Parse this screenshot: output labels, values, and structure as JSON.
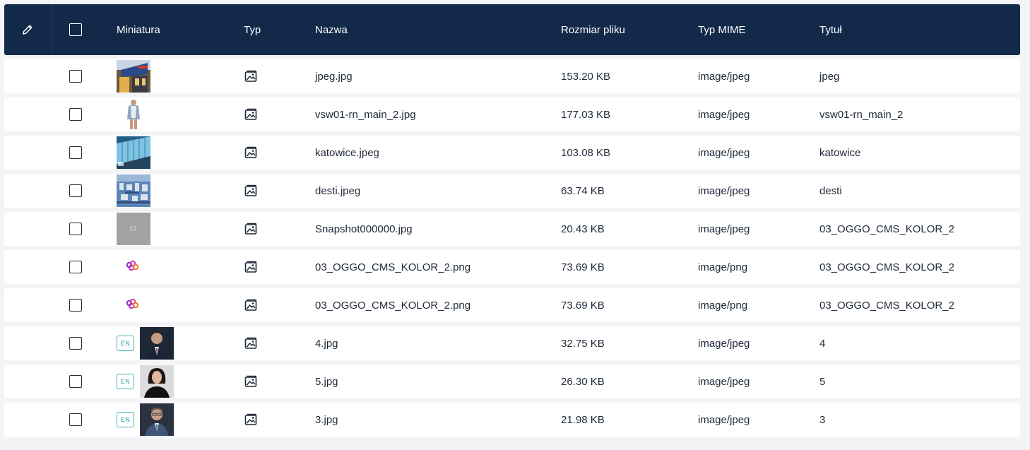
{
  "columns": {
    "thumbnail": "Miniatura",
    "type": "Typ",
    "name": "Nazwa",
    "file_size": "Rozmiar pliku",
    "mime": "Typ MIME",
    "title": "Tytuł"
  },
  "icons": {
    "edit": "pencil-icon",
    "type": "image-icon"
  },
  "rows": [
    {
      "thumb": "photo-building-facade",
      "lang": "",
      "name": "jpeg.jpg",
      "size": "153.20 KB",
      "mime": "image/jpeg",
      "title": "jpeg"
    },
    {
      "thumb": "photo-woman-cardigan",
      "lang": "",
      "name": "vsw01-rn_main_2.jpg",
      "size": "177.03 KB",
      "mime": "image/jpeg",
      "title": "vsw01-rn_main_2"
    },
    {
      "thumb": "photo-glass-building",
      "lang": "",
      "name": "katowice.jpeg",
      "size": "103.08 KB",
      "mime": "image/jpeg",
      "title": "katowice"
    },
    {
      "thumb": "photo-aerial-city",
      "lang": "",
      "name": "desti.jpeg",
      "size": "63.74 KB",
      "mime": "image/jpeg",
      "title": "desti"
    },
    {
      "thumb": "photo-gray-placeholder",
      "lang": "",
      "name": "Snapshot000000.jpg",
      "size": "20.43 KB",
      "mime": "image/jpeg",
      "title": "03_OGGO_CMS_KOLOR_2"
    },
    {
      "thumb": "logo-oggo",
      "lang": "",
      "name": "03_OGGO_CMS_KOLOR_2.png",
      "size": "73.69 KB",
      "mime": "image/png",
      "title": "03_OGGO_CMS_KOLOR_2"
    },
    {
      "thumb": "logo-oggo",
      "lang": "",
      "name": "03_OGGO_CMS_KOLOR_2.png",
      "size": "73.69 KB",
      "mime": "image/png",
      "title": "03_OGGO_CMS_KOLOR_2"
    },
    {
      "thumb": "portrait-man-suit",
      "lang": "EN",
      "name": "4.jpg",
      "size": "32.75 KB",
      "mime": "image/jpeg",
      "title": "4"
    },
    {
      "thumb": "portrait-woman",
      "lang": "EN",
      "name": "5.jpg",
      "size": "26.30 KB",
      "mime": "image/jpeg",
      "title": "5"
    },
    {
      "thumb": "portrait-man-glasses",
      "lang": "EN",
      "name": "3.jpg",
      "size": "21.98 KB",
      "mime": "image/jpeg",
      "title": "3"
    }
  ],
  "colors": {
    "header_bg": "#12294a",
    "page_bg": "#f3f4f6",
    "row_bg": "#ffffff",
    "lang_badge": "#3fb0ba"
  }
}
